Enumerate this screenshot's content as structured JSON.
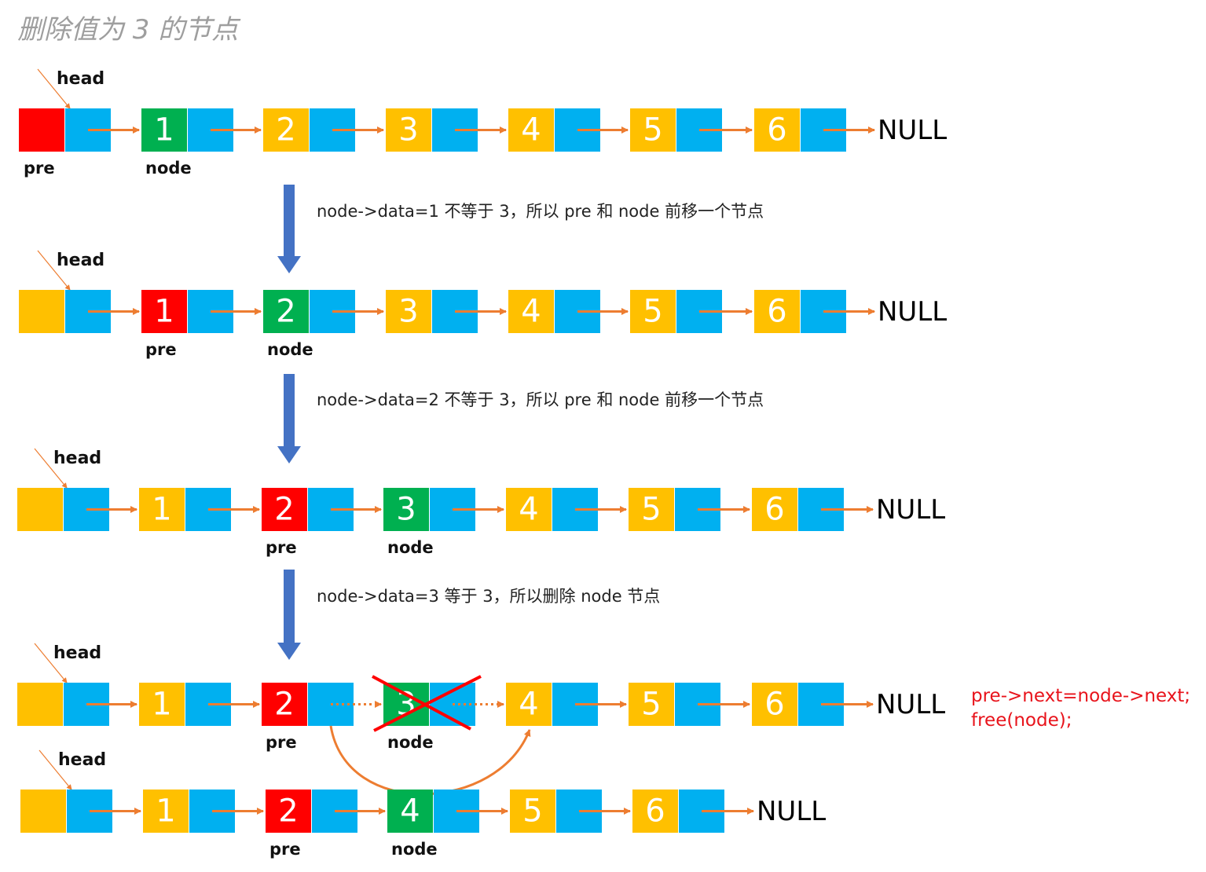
{
  "title": "删除值为 3 的节点",
  "colors": {
    "green": "#00b050",
    "red": "#ff0000",
    "yellow": "#ffc000",
    "blue": "#00b0f0",
    "arrow": "#ed7d31",
    "down_arrow": "#4472c4",
    "cross": "#ff0000",
    "code": "#e8131b"
  },
  "labels": {
    "head": "head",
    "pre": "pre",
    "node": "node",
    "null": "NULL"
  },
  "captions": [
    "node->data=1 不等于 3，所以 pre 和 node 前移一个节点",
    "node->data=2 不等于 3，所以 pre 和 node 前移一个节点",
    "node->data=3 等于 3，所以删除 node 节点"
  ],
  "code_lines": [
    "pre->next=node->next;",
    "free(node);"
  ],
  "rows": [
    {
      "step": 1,
      "nodes": [
        {
          "value": "",
          "color": "red",
          "label": "pre"
        },
        {
          "value": "1",
          "color": "green",
          "label": "node"
        },
        {
          "value": "2",
          "color": "yellow",
          "label": ""
        },
        {
          "value": "3",
          "color": "yellow",
          "label": ""
        },
        {
          "value": "4",
          "color": "yellow",
          "label": ""
        },
        {
          "value": "5",
          "color": "yellow",
          "label": ""
        },
        {
          "value": "6",
          "color": "yellow",
          "label": ""
        }
      ]
    },
    {
      "step": 2,
      "nodes": [
        {
          "value": "",
          "color": "yellow",
          "label": ""
        },
        {
          "value": "1",
          "color": "red",
          "label": "pre"
        },
        {
          "value": "2",
          "color": "green",
          "label": "node"
        },
        {
          "value": "3",
          "color": "yellow",
          "label": ""
        },
        {
          "value": "4",
          "color": "yellow",
          "label": ""
        },
        {
          "value": "5",
          "color": "yellow",
          "label": ""
        },
        {
          "value": "6",
          "color": "yellow",
          "label": ""
        }
      ]
    },
    {
      "step": 3,
      "nodes": [
        {
          "value": "",
          "color": "yellow",
          "label": ""
        },
        {
          "value": "1",
          "color": "yellow",
          "label": ""
        },
        {
          "value": "2",
          "color": "red",
          "label": "pre"
        },
        {
          "value": "3",
          "color": "green",
          "label": "node"
        },
        {
          "value": "4",
          "color": "yellow",
          "label": ""
        },
        {
          "value": "5",
          "color": "yellow",
          "label": ""
        },
        {
          "value": "6",
          "color": "yellow",
          "label": ""
        }
      ]
    },
    {
      "step": 4,
      "nodes": [
        {
          "value": "",
          "color": "yellow",
          "label": ""
        },
        {
          "value": "1",
          "color": "yellow",
          "label": ""
        },
        {
          "value": "2",
          "color": "red",
          "label": "pre"
        },
        {
          "value": "3",
          "color": "green",
          "label": "node",
          "deleted": true
        },
        {
          "value": "4",
          "color": "yellow",
          "label": ""
        },
        {
          "value": "5",
          "color": "yellow",
          "label": ""
        },
        {
          "value": "6",
          "color": "yellow",
          "label": ""
        }
      ]
    },
    {
      "step": 5,
      "nodes": [
        {
          "value": "",
          "color": "yellow",
          "label": ""
        },
        {
          "value": "1",
          "color": "yellow",
          "label": ""
        },
        {
          "value": "2",
          "color": "red",
          "label": "pre"
        },
        {
          "value": "4",
          "color": "green",
          "label": "node"
        },
        {
          "value": "5",
          "color": "yellow",
          "label": ""
        },
        {
          "value": "6",
          "color": "yellow",
          "label": ""
        }
      ]
    }
  ]
}
